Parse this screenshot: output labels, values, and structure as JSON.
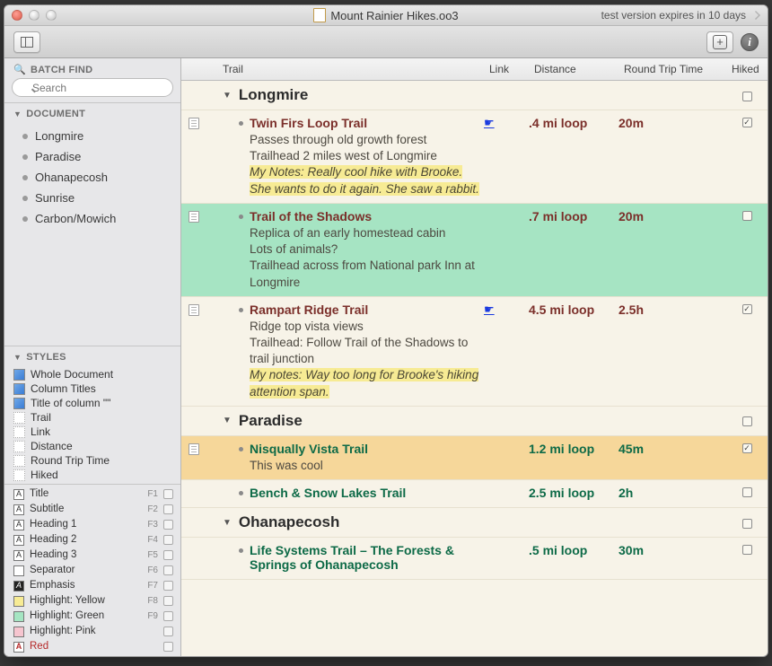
{
  "window": {
    "title": "Mount Rainier Hikes.oo3",
    "expiry_text": "test version expires in 10 days"
  },
  "sidebar": {
    "batch_find_label": "BATCH FIND",
    "search_placeholder": "Search",
    "document_label": "DOCUMENT",
    "doc_items": [
      "Longmire",
      "Paradise",
      "Ohanapecosh",
      "Sunrise",
      "Carbon/Mowich"
    ],
    "styles_label": "STYLES",
    "styles": [
      {
        "label": "Whole Document",
        "swatch": "sw-blue"
      },
      {
        "label": "Column Titles",
        "swatch": "sw-blue"
      },
      {
        "label": "Title of column \"\"",
        "swatch": "sw-blue"
      },
      {
        "label": "Trail",
        "swatch": "sw-dotted"
      },
      {
        "label": "Link",
        "swatch": "sw-dotted"
      },
      {
        "label": "Distance",
        "swatch": "sw-dotted"
      },
      {
        "label": "Round Trip Time",
        "swatch": "sw-dotted"
      },
      {
        "label": "Hiked",
        "swatch": "sw-dotted"
      }
    ],
    "fkeys": [
      {
        "swatch": "plain",
        "letter": "A",
        "label": "Title",
        "key": "F1"
      },
      {
        "swatch": "plain",
        "letter": "A",
        "label": "Subtitle",
        "key": "F2"
      },
      {
        "swatch": "plain",
        "letter": "A",
        "label": "Heading 1",
        "key": "F3"
      },
      {
        "swatch": "plain",
        "letter": "A",
        "label": "Heading 2",
        "key": "F4"
      },
      {
        "swatch": "plain",
        "letter": "A",
        "label": "Heading 3",
        "key": "F5"
      },
      {
        "swatch": "plain",
        "letter": "",
        "label": "Separator",
        "key": "F6"
      },
      {
        "swatch": "black",
        "letter": "A",
        "label": "Emphasis",
        "key": "F7"
      },
      {
        "swatch": "yellow",
        "letter": "",
        "label": "Highlight: Yellow",
        "key": "F8"
      },
      {
        "swatch": "green",
        "letter": "",
        "label": "Highlight: Green",
        "key": "F9"
      },
      {
        "swatch": "pink",
        "letter": "",
        "label": "Highlight: Pink",
        "key": ""
      },
      {
        "swatch": "plain",
        "letter": "A",
        "label": "Red",
        "key": "",
        "red": true
      }
    ]
  },
  "columns": {
    "trail": "Trail",
    "link": "Link",
    "distance": "Distance",
    "round_trip": "Round Trip Time",
    "hiked": "Hiked"
  },
  "sections": [
    {
      "name": "Longmire",
      "rows": [
        {
          "title": "Twin Firs Loop Trail",
          "color": "red",
          "desc": [
            "Passes through old growth forest",
            "Trailhead 2 miles west of Longmire"
          ],
          "notes": "My Notes: Really cool hike with Brooke. She wants to do it again. She saw a rabbit.",
          "link": true,
          "dist": ".4 mi loop",
          "rt": "20m",
          "hiked": true,
          "note_icon": true
        },
        {
          "title": "Trail of the Shadows",
          "color": "red",
          "desc": [
            "Replica of an early homestead cabin",
            "Lots of animals?",
            "Trailhead across from National park Inn at Longmire"
          ],
          "dist": ".7 mi loop",
          "rt": "20m",
          "hiked": false,
          "bg": "green",
          "note_icon": true
        },
        {
          "title": "Rampart Ridge Trail",
          "color": "red",
          "desc": [
            "Ridge top vista views",
            "Trailhead: Follow Trail of the Shadows to trail junction"
          ],
          "notes": "My notes: Way too long for Brooke's hiking attention span.",
          "link": true,
          "dist": "4.5 mi loop",
          "rt": "2.5h",
          "hiked": true,
          "note_icon": true
        }
      ]
    },
    {
      "name": "Paradise",
      "rows": [
        {
          "title": "Nisqually Vista Trail",
          "color": "green",
          "desc": [
            "This was cool"
          ],
          "dist": "1.2 mi loop",
          "rt": "45m",
          "hiked": true,
          "bg": "orange",
          "note_icon": true
        },
        {
          "title": "Bench & Snow Lakes Trail",
          "color": "green",
          "dist": "2.5 mi loop",
          "rt": "2h",
          "hiked": false
        }
      ]
    },
    {
      "name": "Ohanapecosh",
      "rows": [
        {
          "title": "Life Systems Trail – The Forests & Springs of Ohanapecosh",
          "color": "green",
          "dist": ".5 mi loop",
          "rt": "30m",
          "hiked": false
        }
      ]
    }
  ]
}
